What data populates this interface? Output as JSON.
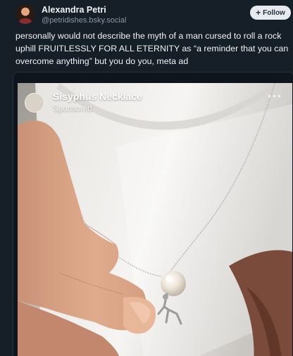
{
  "author": {
    "display_name": "Alexandra Petri",
    "handle": "@petridishes.bsky.social",
    "avatar_icon": "avatar"
  },
  "follow_button": {
    "icon": "plus-icon",
    "label": "Follow"
  },
  "post": {
    "text": "personally would not describe the myth of a man cursed to roll a rock uphill FRUITLESSLY FOR ALL ETERNITY as “a reminder that you can overcome anything” but you do you, meta ad"
  },
  "embed": {
    "ad_title": "Sisyphus Necklace",
    "ad_subtitle": "Sponsored",
    "more_icon": "more-horizontal-icon",
    "more_glyph": "···"
  },
  "colors": {
    "background": "#161e27",
    "text": "#f1f3f5",
    "muted": "#8b98a5",
    "follow_bg": "#e7ebef"
  }
}
